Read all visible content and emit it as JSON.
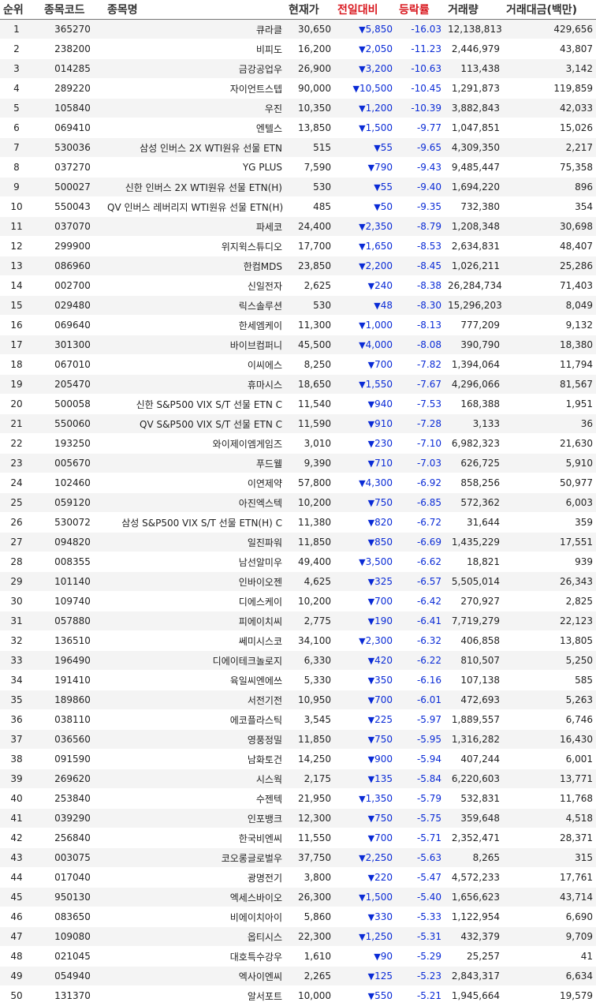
{
  "headers": [
    "순위",
    "종목코드",
    "종목명",
    "현재가",
    "전일대비",
    "등락률",
    "거래량",
    "거래대금(백만)"
  ],
  "down_symbol": "▼",
  "colors": {
    "down": "#0a2bd6",
    "header_accent": "#d9181f",
    "row_alt": "#f4f4f4"
  },
  "rows": [
    [
      "1",
      "365270",
      "큐라클",
      "30,650",
      "5,850",
      "-16.03",
      "12,138,813",
      "429,656"
    ],
    [
      "2",
      "238200",
      "비피도",
      "16,200",
      "2,050",
      "-11.23",
      "2,446,979",
      "43,807"
    ],
    [
      "3",
      "014285",
      "금강공업우",
      "26,900",
      "3,200",
      "-10.63",
      "113,438",
      "3,142"
    ],
    [
      "4",
      "289220",
      "자이언트스텝",
      "90,000",
      "10,500",
      "-10.45",
      "1,291,873",
      "119,859"
    ],
    [
      "5",
      "105840",
      "우진",
      "10,350",
      "1,200",
      "-10.39",
      "3,882,843",
      "42,033"
    ],
    [
      "6",
      "069410",
      "엔텔스",
      "13,850",
      "1,500",
      "-9.77",
      "1,047,851",
      "15,026"
    ],
    [
      "7",
      "530036",
      "삼성 인버스 2X WTI원유 선물 ETN",
      "515",
      "55",
      "-9.65",
      "4,309,350",
      "2,217"
    ],
    [
      "8",
      "037270",
      "YG PLUS",
      "7,590",
      "790",
      "-9.43",
      "9,485,447",
      "75,358"
    ],
    [
      "9",
      "500027",
      "신한 인버스 2X WTI원유 선물 ETN(H)",
      "530",
      "55",
      "-9.40",
      "1,694,220",
      "896"
    ],
    [
      "10",
      "550043",
      "QV 인버스 레버리지 WTI원유 선물 ETN(H)",
      "485",
      "50",
      "-9.35",
      "732,380",
      "354"
    ],
    [
      "11",
      "037070",
      "파세코",
      "24,400",
      "2,350",
      "-8.79",
      "1,208,348",
      "30,698"
    ],
    [
      "12",
      "299900",
      "위지윅스튜디오",
      "17,700",
      "1,650",
      "-8.53",
      "2,634,831",
      "48,407"
    ],
    [
      "13",
      "086960",
      "한컴MDS",
      "23,850",
      "2,200",
      "-8.45",
      "1,026,211",
      "25,286"
    ],
    [
      "14",
      "002700",
      "신일전자",
      "2,625",
      "240",
      "-8.38",
      "26,284,734",
      "71,403"
    ],
    [
      "15",
      "029480",
      "릭스솔루션",
      "530",
      "48",
      "-8.30",
      "15,296,203",
      "8,049"
    ],
    [
      "16",
      "069640",
      "한세엠케이",
      "11,300",
      "1,000",
      "-8.13",
      "777,209",
      "9,132"
    ],
    [
      "17",
      "301300",
      "바이브컴퍼니",
      "45,500",
      "4,000",
      "-8.08",
      "390,790",
      "18,380"
    ],
    [
      "18",
      "067010",
      "이씨에스",
      "8,250",
      "700",
      "-7.82",
      "1,394,064",
      "11,794"
    ],
    [
      "19",
      "205470",
      "휴마시스",
      "18,650",
      "1,550",
      "-7.67",
      "4,296,066",
      "81,567"
    ],
    [
      "20",
      "500058",
      "신한 S&P500 VIX S/T 선물 ETN C",
      "11,540",
      "940",
      "-7.53",
      "168,388",
      "1,951"
    ],
    [
      "21",
      "550060",
      "QV S&P500 VIX S/T 선물 ETN C",
      "11,590",
      "910",
      "-7.28",
      "3,133",
      "36"
    ],
    [
      "22",
      "193250",
      "와이제이엠게임즈",
      "3,010",
      "230",
      "-7.10",
      "6,982,323",
      "21,630"
    ],
    [
      "23",
      "005670",
      "푸드웰",
      "9,390",
      "710",
      "-7.03",
      "626,725",
      "5,910"
    ],
    [
      "24",
      "102460",
      "이연제약",
      "57,800",
      "4,300",
      "-6.92",
      "858,256",
      "50,977"
    ],
    [
      "25",
      "059120",
      "아진엑스텍",
      "10,200",
      "750",
      "-6.85",
      "572,362",
      "6,003"
    ],
    [
      "26",
      "530072",
      "삼성 S&P500 VIX S/T 선물 ETN(H) C",
      "11,380",
      "820",
      "-6.72",
      "31,644",
      "359"
    ],
    [
      "27",
      "094820",
      "일진파워",
      "11,850",
      "850",
      "-6.69",
      "1,435,229",
      "17,551"
    ],
    [
      "28",
      "008355",
      "남선알미우",
      "49,400",
      "3,500",
      "-6.62",
      "18,821",
      "939"
    ],
    [
      "29",
      "101140",
      "인바이오젠",
      "4,625",
      "325",
      "-6.57",
      "5,505,014",
      "26,343"
    ],
    [
      "30",
      "109740",
      "디에스케이",
      "10,200",
      "700",
      "-6.42",
      "270,927",
      "2,825"
    ],
    [
      "31",
      "057880",
      "피에이치씨",
      "2,775",
      "190",
      "-6.41",
      "7,719,279",
      "22,123"
    ],
    [
      "32",
      "136510",
      "쎄미시스코",
      "34,100",
      "2,300",
      "-6.32",
      "406,858",
      "13,805"
    ],
    [
      "33",
      "196490",
      "디에이테크놀로지",
      "6,330",
      "420",
      "-6.22",
      "810,507",
      "5,250"
    ],
    [
      "34",
      "191410",
      "육일씨엔에쓰",
      "5,330",
      "350",
      "-6.16",
      "107,138",
      "585"
    ],
    [
      "35",
      "189860",
      "서전기전",
      "10,950",
      "700",
      "-6.01",
      "472,693",
      "5,263"
    ],
    [
      "36",
      "038110",
      "에코플라스틱",
      "3,545",
      "225",
      "-5.97",
      "1,889,557",
      "6,746"
    ],
    [
      "37",
      "036560",
      "영풍정밀",
      "11,850",
      "750",
      "-5.95",
      "1,316,282",
      "16,430"
    ],
    [
      "38",
      "091590",
      "남화토건",
      "14,250",
      "900",
      "-5.94",
      "407,244",
      "6,001"
    ],
    [
      "39",
      "269620",
      "시스웍",
      "2,175",
      "135",
      "-5.84",
      "6,220,603",
      "13,771"
    ],
    [
      "40",
      "253840",
      "수젠텍",
      "21,950",
      "1,350",
      "-5.79",
      "532,831",
      "11,768"
    ],
    [
      "41",
      "039290",
      "인포뱅크",
      "12,300",
      "750",
      "-5.75",
      "359,648",
      "4,518"
    ],
    [
      "42",
      "256840",
      "한국비엔씨",
      "11,550",
      "700",
      "-5.71",
      "2,352,471",
      "28,371"
    ],
    [
      "43",
      "003075",
      "코오롱글로벌우",
      "37,750",
      "2,250",
      "-5.63",
      "8,265",
      "315"
    ],
    [
      "44",
      "017040",
      "광명전기",
      "3,800",
      "220",
      "-5.47",
      "4,572,233",
      "17,761"
    ],
    [
      "45",
      "950130",
      "엑세스바이오",
      "26,300",
      "1,500",
      "-5.40",
      "1,656,623",
      "43,714"
    ],
    [
      "46",
      "083650",
      "비에이치아이",
      "5,860",
      "330",
      "-5.33",
      "1,122,954",
      "6,690"
    ],
    [
      "47",
      "109080",
      "옵티시스",
      "22,300",
      "1,250",
      "-5.31",
      "432,379",
      "9,709"
    ],
    [
      "48",
      "021045",
      "대호특수강우",
      "1,610",
      "90",
      "-5.29",
      "25,257",
      "41"
    ],
    [
      "49",
      "054940",
      "엑사이엔씨",
      "2,265",
      "125",
      "-5.23",
      "2,843,317",
      "6,634"
    ],
    [
      "50",
      "131370",
      "알서포트",
      "10,000",
      "550",
      "-5.21",
      "1,945,664",
      "19,579"
    ]
  ]
}
